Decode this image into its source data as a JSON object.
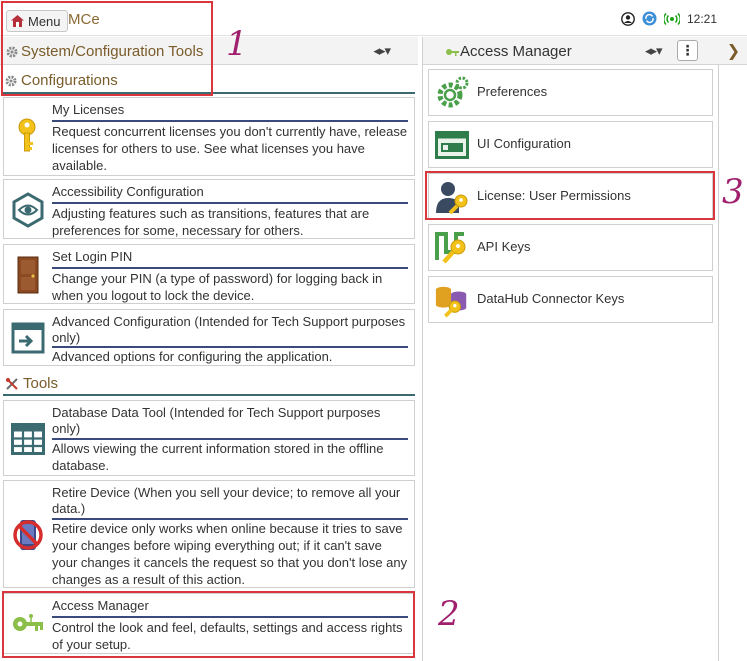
{
  "topbar": {
    "menu_label": "Menu",
    "app_name": "MCe",
    "time": "12:21"
  },
  "left_panel": {
    "header_title": "System/Configuration Tools",
    "header_toggle": "◂▸▾",
    "sections": {
      "configurations": {
        "title": "Configurations",
        "cards": [
          {
            "icon": "key-icon",
            "title": "My Licenses",
            "desc": "Request concurrent licenses you don't currently have, release licenses for others to use. See what licenses you have available."
          },
          {
            "icon": "eye-cube-icon",
            "title": "Accessibility Configuration",
            "desc": "Adjusting features such as transitions, features that are preferences for some, necessary for others."
          },
          {
            "icon": "door-icon",
            "title": "Set Login PIN",
            "desc": "Change your PIN (a type of password) for logging back in when you logout to lock the device."
          },
          {
            "icon": "window-arrow-icon",
            "title": "Advanced Configuration (Intended for Tech Support purposes only)",
            "desc": "Advanced options for configuring the application."
          }
        ]
      },
      "tools": {
        "title": "Tools",
        "cards": [
          {
            "icon": "table-icon",
            "title": "Database Data Tool (Intended for Tech Support purposes only)",
            "desc": "Allows viewing the current information stored in the offline database."
          },
          {
            "icon": "no-device-icon",
            "title": "Retire Device (When you sell your device; to remove all your data.)",
            "desc": "Retire device only works when online because it tries to save your changes before wiping everything out; if it can't save your changes it cancels the request so that you don't lose any changes as a result of this action."
          },
          {
            "icon": "circuit-key-icon",
            "title": "Access Manager",
            "desc": "Control the look and feel, defaults, settings and access rights of your setup."
          }
        ]
      }
    }
  },
  "right_panel": {
    "header_title": "Access Manager",
    "header_toggle": "◂▸▾",
    "items": [
      {
        "icon": "gears-icon",
        "label": "Preferences"
      },
      {
        "icon": "ui-window-icon",
        "label": "UI Configuration"
      },
      {
        "icon": "user-key-icon",
        "label": "License: User Permissions"
      },
      {
        "icon": "api-key-icon",
        "label": "API Keys"
      },
      {
        "icon": "database-key-icon",
        "label": "DataHub Connector Keys"
      }
    ]
  },
  "annotations": [
    "1",
    "2",
    "3"
  ],
  "colors": {
    "section_title": "#7a5c2a",
    "section_line": "#3b6a70",
    "card_rule": "#3a4a7a",
    "annotation_box": "#d9363e",
    "annotation_number": "#a0206e"
  }
}
